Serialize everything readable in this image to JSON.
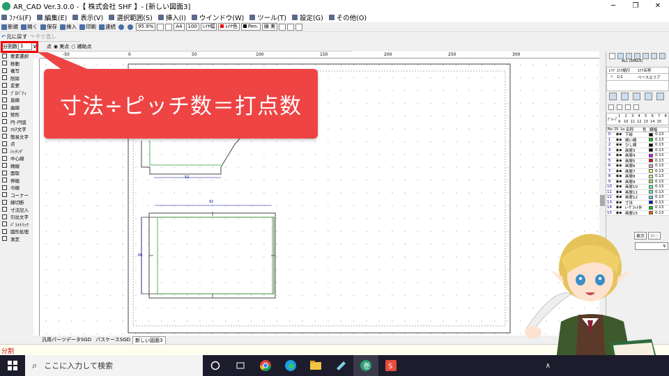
{
  "window": {
    "title": "AR_CAD Ver.3.0.0  -【 株式会社 SHF 】- [新しい図面3]"
  },
  "menu": [
    "ﾌｧｲﾙ(F)",
    "編集(E)",
    "表示(V)",
    "選択範囲(S)",
    "挿入(I)",
    "ウインドウ(W)",
    "ツール(T)",
    "設定(G)",
    "その他(O)"
  ],
  "toolbar1": {
    "new": "新規",
    "open": "開く",
    "save": "保存",
    "insert": "挿入",
    "print": "印刷",
    "continuous": "連続",
    "zoom": "95.9%",
    "paper": "A4",
    "scale": "100",
    "layer_width": "ﾚｲﾔ幅",
    "layer_color": "ﾚｲﾔ色",
    "pen": "Pen.",
    "line": "実",
    "line_label": "線"
  },
  "toolbar2": {
    "undo": "元に戻す",
    "redo": "やり直し"
  },
  "optbar": {
    "divide_label": "分割数",
    "divide_value": "1",
    "radio1": "点",
    "radio2": "実点",
    "radio3": "補助点"
  },
  "commands": [
    "要素選択",
    "移動",
    "複写",
    "削除",
    "変更",
    "ﾌﾟﾛﾊﾟﾃｨ",
    "直線",
    "曲線",
    "矩形",
    "円･円弧",
    "ﾏﾙﾁ文字",
    "簡易文字",
    "点",
    "ﾊｯﾁﾝｸﾞ",
    "中心線",
    "精線",
    "面取",
    "伸縮",
    "巾線",
    "コーナー",
    "線切断",
    "寸法記入",
    "引出文字",
    "ﾊﾟﾗﾒﾄﾘｯｸ",
    "図形処理",
    "測定"
  ],
  "ruler": {
    "top": [
      "-50",
      "0",
      "50",
      "100",
      "150",
      "200",
      "250",
      "300"
    ]
  },
  "drawing": {
    "dim1": "52",
    "dim2": "92",
    "dim3": "60"
  },
  "callout": {
    "text": "寸法÷ピッチ数＝打点数"
  },
  "tabs": [
    "汎用パーツデータSGD",
    "パスケースSGD",
    "新しい図面3"
  ],
  "status": {
    "text": "分割"
  },
  "rightpanel": {
    "area_header": [
      "ﾚｲｱ",
      "ｴﾘｱ縮尺",
      "ｴﾘｱ名称"
    ],
    "area_row": [
      "1/1",
      "ベースエリア"
    ],
    "all_space": "ALL (SPACE)",
    "group_label": "ｸﾞﾙｰﾌﾟ",
    "group_numbers": [
      "1",
      "2",
      "3",
      "4",
      "5",
      "6",
      "7",
      "8",
      "9",
      "10",
      "11",
      "12",
      "13",
      "14",
      "15"
    ],
    "layer_header": [
      "No",
      "Di",
      "Lo",
      "名称",
      "色",
      "線幅"
    ],
    "layers": [
      {
        "no": "0",
        "name": "下絵",
        "color": "#000000",
        "width": "0.13"
      },
      {
        "no": "1",
        "name": "細い線",
        "color": "#00cc00",
        "width": "0.13"
      },
      {
        "no": "2",
        "name": "ひし線",
        "color": "#000000",
        "width": "0.13"
      },
      {
        "no": "3",
        "name": "画層3",
        "color": "#000000",
        "width": "0.13"
      },
      {
        "no": "4",
        "name": "画層4",
        "color": "#ff00ff",
        "width": "0.13"
      },
      {
        "no": "5",
        "name": "画層5",
        "color": "#ff0000",
        "width": "0.13"
      },
      {
        "no": "6",
        "name": "画層6",
        "color": "#ff99cc",
        "width": "0.13"
      },
      {
        "no": "7",
        "name": "画層7",
        "color": "#ffff66",
        "width": "0.13"
      },
      {
        "no": "8",
        "name": "画層8",
        "color": "#ccff99",
        "width": "0.13"
      },
      {
        "no": "9",
        "name": "画層9",
        "color": "#99ff66",
        "width": "0.13"
      },
      {
        "no": "10",
        "name": "画層10",
        "color": "#66ff99",
        "width": "0.13"
      },
      {
        "no": "11",
        "name": "画層11",
        "color": "#66ffcc",
        "width": "0.13"
      },
      {
        "no": "12",
        "name": "画層12",
        "color": "#66ccff",
        "width": "0.13"
      },
      {
        "no": "13",
        "name": "寸法",
        "color": "#0000ff",
        "width": "0.13"
      },
      {
        "no": "14",
        "name": "ﾚｰｻﾞｶｯﾄ外",
        "color": "#00cc00",
        "width": "0.13"
      },
      {
        "no": "15",
        "name": "画層15",
        "color": "#ff6600",
        "width": "0.13"
      }
    ],
    "buttons": [
      "表示",
      "縮小"
    ]
  },
  "taskbar": {
    "search_placeholder": "ここに入力して検索",
    "apps": [
      "task-view-icon",
      "chrome-icon",
      "edge-icon",
      "explorer-icon",
      "notepad-icon",
      "arcad-icon",
      "wps-icon"
    ]
  }
}
